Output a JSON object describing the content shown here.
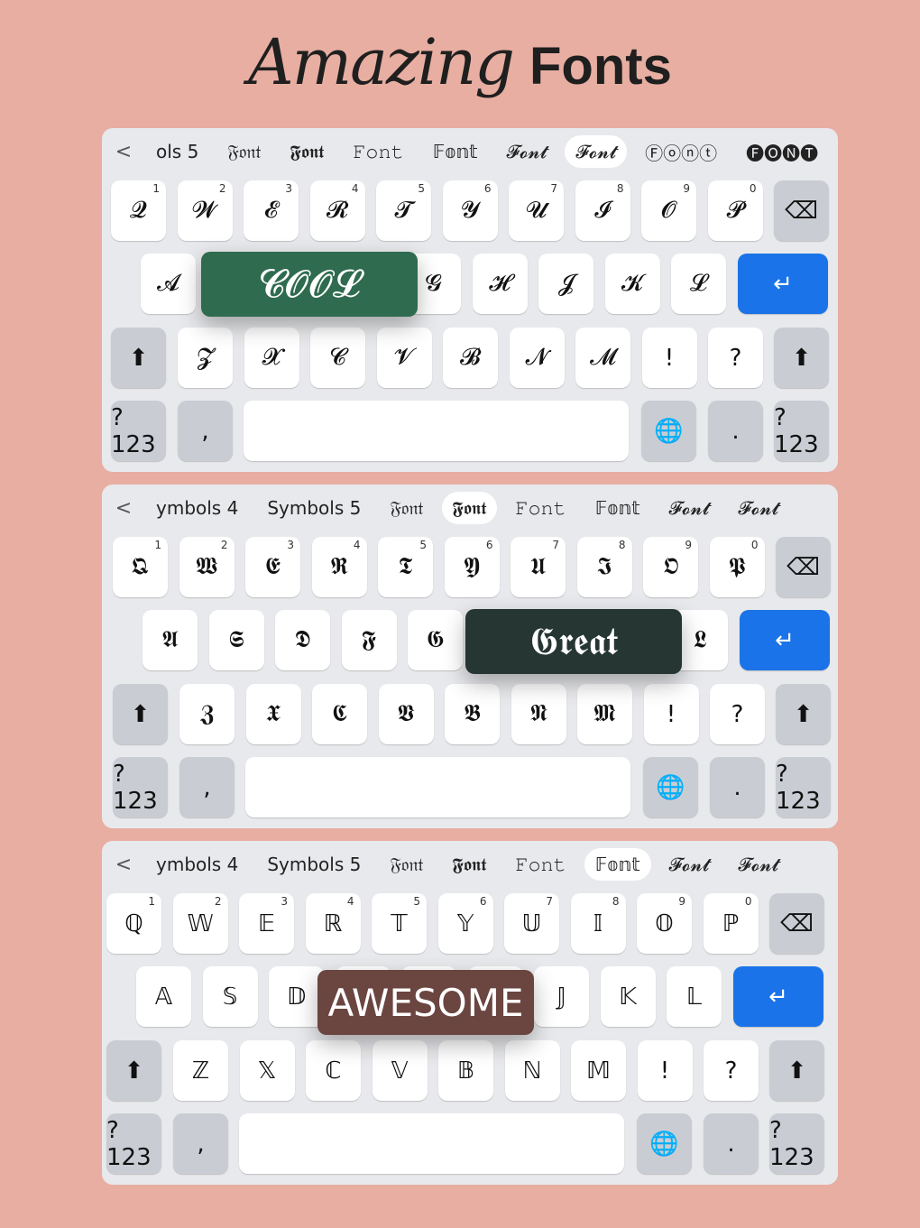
{
  "title": {
    "script": "Amazing",
    "bold": "Fonts"
  },
  "colors": {
    "background": "#e8aea2",
    "keyboard": "#e8e9ec",
    "enter": "#1a73e8"
  },
  "keyboards": [
    {
      "suggestions": [
        "ols 5",
        "𝔉𝔬𝔫𝔱",
        "𝕱𝖔𝖓𝖙",
        "𝙵𝚘𝚗𝚝",
        "𝔽𝕠𝕟𝕥",
        "𝓕𝓸𝓷𝓽",
        "𝓕𝓸𝓷𝓽",
        "Ⓕⓞⓝⓣ",
        "🅕🅞🅝🅣",
        "🄵🄾🄽"
      ],
      "selected": 6,
      "row1": [
        "𝓠",
        "𝓦",
        "𝓔",
        "𝓡",
        "𝓣",
        "𝓨",
        "𝓤",
        "𝓘",
        "𝓞",
        "𝓟"
      ],
      "row2": [
        "𝓐",
        "𝓢",
        "𝓓",
        "𝓕",
        "𝓖",
        "𝓗",
        "𝓙",
        "𝓚",
        "𝓛"
      ],
      "row3": [
        "𝓩",
        "𝓧",
        "𝓒",
        "𝓥",
        "𝓑",
        "𝓝",
        "𝓜",
        "!",
        "?"
      ],
      "popup": {
        "text": "𝓒𝓞𝓞𝓛",
        "color": "#2f6b4f"
      }
    },
    {
      "suggestions": [
        "ymbols 4",
        "Symbols 5",
        "𝔉𝔬𝔫𝔱",
        "𝕱𝖔𝖓𝖙",
        "𝙵𝚘𝚗𝚝",
        "𝔽𝕠𝕟𝕥",
        "𝓕𝓸𝓷𝓽",
        "𝓕𝓸𝓷𝓽"
      ],
      "selected": 3,
      "row1": [
        "𝕼",
        "𝖂",
        "𝕰",
        "𝕽",
        "𝕿",
        "𝖄",
        "𝖀",
        "𝕴",
        "𝕺",
        "𝕻"
      ],
      "row2": [
        "𝕬",
        "𝕾",
        "𝕯",
        "𝕱",
        "𝕲",
        "𝕳",
        "𝕵",
        "𝕶",
        "𝕷"
      ],
      "row3": [
        "𝖅",
        "𝖃",
        "𝕮",
        "𝖁",
        "𝕭",
        "𝕹",
        "𝕸",
        "!",
        "?"
      ],
      "popup": {
        "text": "𝕲𝖗𝖊𝖆𝖙",
        "color": "#263632"
      }
    },
    {
      "suggestions": [
        "ymbols 4",
        "Symbols 5",
        "𝔉𝔬𝔫𝔱",
        "𝕱𝖔𝖓𝖙",
        "𝙵𝚘𝚗𝚝",
        "𝔽𝕠𝕟𝕥",
        "𝓕𝓸𝓷𝓽",
        "𝓕𝓸𝓷𝓽"
      ],
      "selected": 5,
      "row1": [
        "ℚ",
        "𝕎",
        "𝔼",
        "ℝ",
        "𝕋",
        "𝕐",
        "𝕌",
        "𝕀",
        "𝕆",
        "ℙ"
      ],
      "row2": [
        "𝔸",
        "𝕊",
        "𝔻",
        "𝔽",
        "𝔾",
        "ℍ",
        "𝕁",
        "𝕂",
        "𝕃"
      ],
      "row3": [
        "ℤ",
        "𝕏",
        "ℂ",
        "𝕍",
        "𝔹",
        "ℕ",
        "𝕄",
        "!",
        "?"
      ],
      "popup": {
        "text": "AWESOME",
        "color": "#6b4540"
      }
    }
  ],
  "numbers": [
    "1",
    "2",
    "3",
    "4",
    "5",
    "6",
    "7",
    "8",
    "9",
    "0"
  ],
  "keys": {
    "symbols": "?123",
    "comma": ",",
    "period": ".",
    "backspace": "⌫",
    "enter": "↵",
    "shift": "⬆",
    "globe": "🌐",
    "share": "<"
  }
}
